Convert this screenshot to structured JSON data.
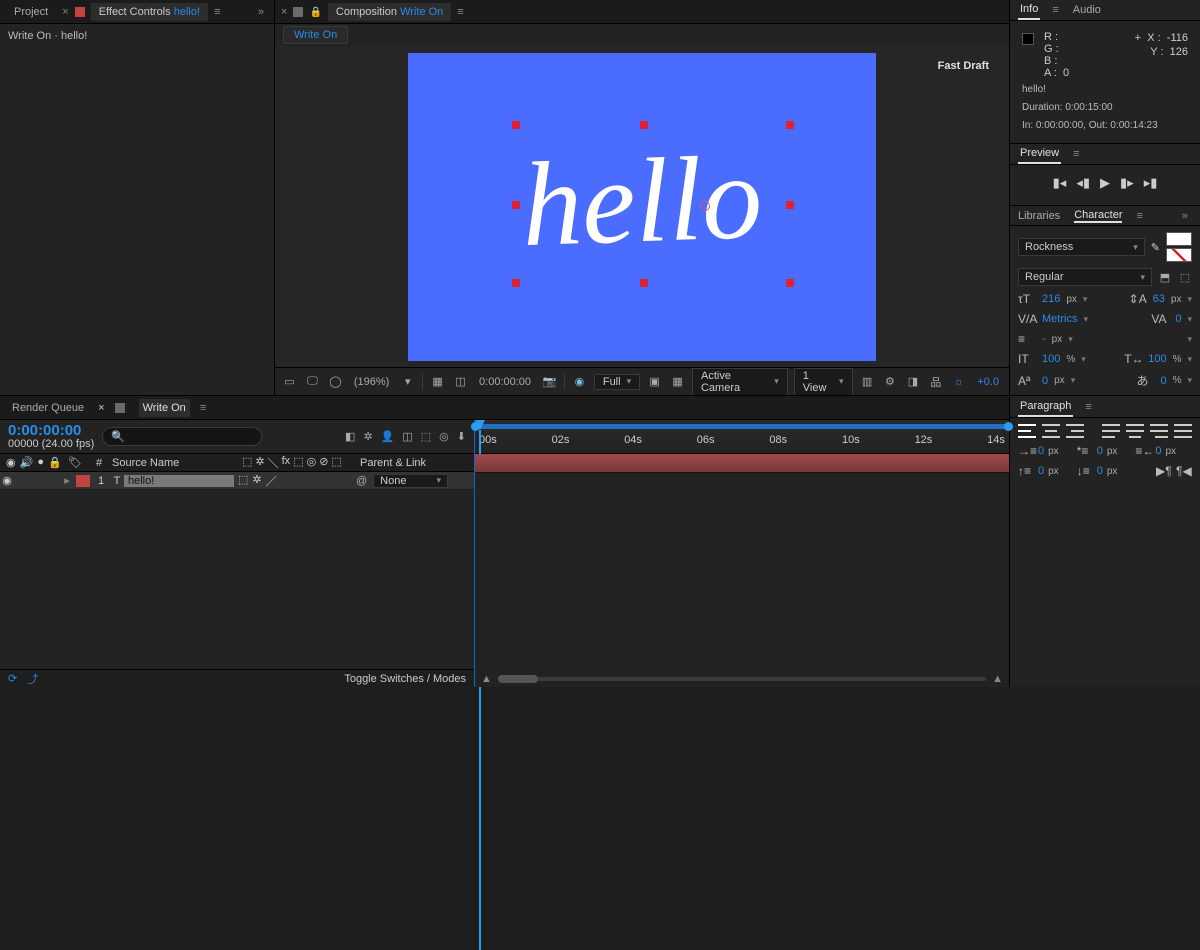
{
  "leftPanel": {
    "tabs": {
      "project": "Project",
      "effectControls": "Effect Controls",
      "layerName": "hello!"
    },
    "body": "Write On · hello!"
  },
  "compPanel": {
    "tabLabel": "Composition",
    "compName": "Write On",
    "subTab": "Write On",
    "fastDraft": "Fast Draft",
    "canvasText": "hello",
    "footer": {
      "zoom": "(196%)",
      "time": "0:00:00:00",
      "resolution": "Full",
      "camera": "Active Camera",
      "views": "1 View",
      "exposure": "+0.0"
    }
  },
  "info": {
    "tabs": {
      "info": "Info",
      "audio": "Audio"
    },
    "rgb": {
      "R": "R :",
      "G": "G :",
      "B": "B :",
      "A": "A :",
      "Aval": "0"
    },
    "xy": {
      "X": "X :",
      "Xval": "-116",
      "Y": "Y :",
      "Yval": "126"
    },
    "meta1": "hello!",
    "meta2": "Duration: 0:00:15:00",
    "meta3": "In: 0:00:00:00, Out: 0:00:14:23"
  },
  "preview": {
    "title": "Preview"
  },
  "character": {
    "tabs": {
      "libraries": "Libraries",
      "character": "Character"
    },
    "font": "Rockness",
    "style": "Regular",
    "fontSize": "216",
    "leading": "63",
    "kerning": "Metrics",
    "tracking": "0",
    "strokeW": "-",
    "fillLabel": "px",
    "vscale": "100",
    "hscale": "100",
    "baseline": "0",
    "tsume": "0",
    "unitPx": "px",
    "unitPct": "%"
  },
  "paragraph": {
    "title": "Paragraph",
    "indentL": "0",
    "indentR": "0",
    "indentFL": "0",
    "spaceBefore": "0",
    "spaceAfter": "0",
    "unit": "px"
  },
  "timeline": {
    "tabs": {
      "renderQueue": "Render Queue",
      "comp": "Write On"
    },
    "timecode": "0:00:00:00",
    "frames": "00000 (24.00 fps)",
    "searchPlaceholder": "",
    "cols": {
      "hash": "#",
      "source": "Source Name",
      "parent": "Parent & Link"
    },
    "layer": {
      "index": "1",
      "type": "T",
      "name": "hello!",
      "parent": "None"
    },
    "ruler": [
      "00s",
      "02s",
      "04s",
      "06s",
      "08s",
      "10s",
      "12s",
      "14s"
    ],
    "footer": "Toggle Switches / Modes"
  }
}
